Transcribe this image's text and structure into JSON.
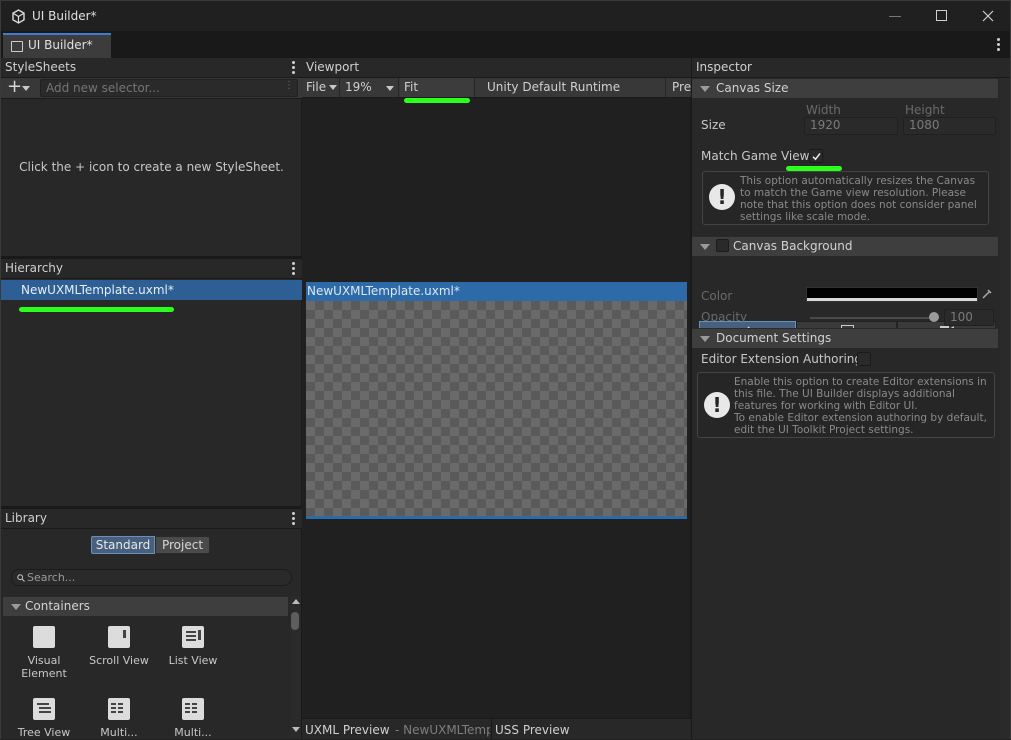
{
  "window": {
    "title": "UI Builder*"
  },
  "tab": {
    "label": "UI Builder*"
  },
  "stylesheets": {
    "header": "StyleSheets",
    "selector_placeholder": "Add new selector...",
    "empty_message": "Click the + icon to create a new StyleSheet."
  },
  "hierarchy": {
    "header": "Hierarchy",
    "item": "NewUXMLTemplate.uxml*"
  },
  "library": {
    "header": "Library",
    "tab_standard": "Standard",
    "tab_project": "Project",
    "search_placeholder": "Search...",
    "section": "Containers",
    "items": [
      "Visual Element",
      "Scroll View",
      "List View",
      "Tree View",
      "Multi...",
      "Multi..."
    ]
  },
  "viewport": {
    "header": "Viewport",
    "file_menu": "File",
    "zoom": "19%",
    "fit_button": "Fit viewport",
    "theme": "Unity Default Runtime Theme",
    "preview_cut": "Pre",
    "canvas_title": "NewUXMLTemplate.uxml*",
    "uxml_preview": "UXML Preview",
    "uxml_preview_file": "- NewUXMLTemp",
    "uss_preview": "USS Preview"
  },
  "inspector": {
    "header": "Inspector",
    "canvas_size": {
      "title": "Canvas Size",
      "size_label": "Size",
      "width_label": "Width",
      "height_label": "Height",
      "width": "1920",
      "height": "1080",
      "match_label": "Match Game View",
      "match_checked": true,
      "help": "This option automatically resizes the Canvas to match the Game view resolution. Please note that this option does not consider panel settings like scale mode."
    },
    "canvas_background": {
      "title": "Canvas Background",
      "color_label": "Color",
      "opacity_label": "Opacity",
      "opacity": "100"
    },
    "document_settings": {
      "title": "Document Settings",
      "editor_ext_label": "Editor Extension Authoring",
      "help_line1": "Enable this option to create Editor extensions in this file. The UI Builder displays additional features for working with Editor UI.",
      "help_line2": "To enable Editor extension authoring by default, edit the UI Toolkit Project settings."
    }
  },
  "colors": {
    "accent": "#2d6ba8",
    "highlight": "#2bff1c",
    "panel": "#282828",
    "viewport": "#202020"
  }
}
